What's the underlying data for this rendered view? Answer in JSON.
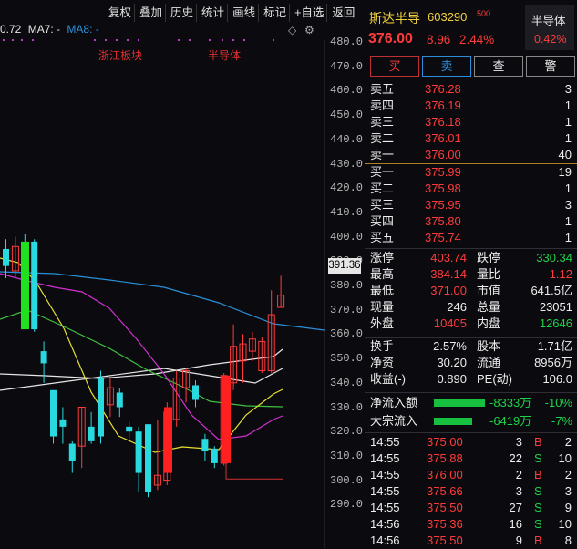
{
  "toolbar": {
    "buttons": [
      "复权",
      "叠加",
      "历史",
      "统计",
      "画线",
      "标记",
      "+自选",
      "返回"
    ]
  },
  "ma": {
    "prefix": "0.72",
    "ma7": "MA7: -",
    "ma8": "MA8: -"
  },
  "tags": {
    "t1": "浙江板块",
    "t2": "半导体"
  },
  "yaxis": [
    "480.0",
    "470.0",
    "460.0",
    "450.0",
    "440.0",
    "430.0",
    "420.0",
    "410.0",
    "400.0",
    "390.0",
    "380.0",
    "370.0",
    "360.0",
    "350.0",
    "340.0",
    "330.0",
    "320.0",
    "310.0",
    "300.0",
    "290.0"
  ],
  "price_marker": "391.36",
  "stock": {
    "name": "斯达半导",
    "code": "603290",
    "sup": "500",
    "price": "376.00",
    "change": "8.96",
    "pct": "2.44%",
    "sector": "半导体",
    "sector_pct": "0.42%"
  },
  "actions": {
    "buy": "买",
    "sell": "卖",
    "query": "查",
    "alert": "警"
  },
  "colors": {
    "up": "#ff3b3b",
    "down": "#1fd14a",
    "ma_white": "#e6e6e6",
    "ma_yellow": "#e8e030",
    "ma_magenta": "#d030d0",
    "ma_green": "#40c040",
    "ma_blue": "#2a8fd8"
  },
  "asks": [
    {
      "label": "卖五",
      "price": "376.28",
      "vol": "3"
    },
    {
      "label": "卖四",
      "price": "376.19",
      "vol": "1"
    },
    {
      "label": "卖三",
      "price": "376.18",
      "vol": "1"
    },
    {
      "label": "卖二",
      "price": "376.01",
      "vol": "1"
    },
    {
      "label": "卖一",
      "price": "376.00",
      "vol": "40"
    }
  ],
  "bids": [
    {
      "label": "买一",
      "price": "375.99",
      "vol": "19"
    },
    {
      "label": "买二",
      "price": "375.98",
      "vol": "1"
    },
    {
      "label": "买三",
      "price": "375.95",
      "vol": "3"
    },
    {
      "label": "买四",
      "price": "375.80",
      "vol": "1"
    },
    {
      "label": "买五",
      "price": "375.74",
      "vol": "1"
    }
  ],
  "stats": {
    "zt_label": "涨停",
    "zt": "403.74",
    "dt_label": "跌停",
    "dt": "330.34",
    "high_label": "最高",
    "high": "384.14",
    "lb_label": "量比",
    "lb": "1.12",
    "low_label": "最低",
    "low": "371.00",
    "mv_label": "市值",
    "mv": "641.5亿",
    "xs_label": "现量",
    "xs": "246",
    "zl_label": "总量",
    "zl": "23051",
    "wp_label": "外盘",
    "wp": "10405",
    "np_label": "内盘",
    "np": "12646",
    "hs_label": "换手",
    "hs": "2.57%",
    "gb_label": "股本",
    "gb": "1.71亿",
    "jz_label": "净资",
    "jz": "30.20",
    "lt_label": "流通",
    "lt": "8956万",
    "sy_label": "收益(-)",
    "sy": "0.890",
    "pe_label": "PE(动)",
    "pe": "106.0"
  },
  "flows": [
    {
      "label": "净流入额",
      "value": "-8333万",
      "pct": "-10%",
      "bar": 0.1
    },
    {
      "label": "大宗流入",
      "value": "-6419万",
      "pct": "-7%",
      "bar": 0.07
    }
  ],
  "ticks": [
    {
      "time": "14:55",
      "price": "375.00",
      "vol": "3",
      "side": "B",
      "num": "2"
    },
    {
      "time": "14:55",
      "price": "375.88",
      "vol": "22",
      "side": "S",
      "num": "10"
    },
    {
      "time": "14:55",
      "price": "376.00",
      "vol": "2",
      "side": "B",
      "num": "2"
    },
    {
      "time": "14:55",
      "price": "375.66",
      "vol": "3",
      "side": "S",
      "num": "3"
    },
    {
      "time": "14:55",
      "price": "375.50",
      "vol": "27",
      "side": "S",
      "num": "9"
    },
    {
      "time": "14:56",
      "price": "375.36",
      "vol": "16",
      "side": "S",
      "num": "10"
    },
    {
      "time": "14:56",
      "price": "375.50",
      "vol": "9",
      "side": "B",
      "num": "8"
    }
  ],
  "chart_data": {
    "type": "candlestick",
    "price_range": [
      285,
      485
    ],
    "candles": [
      {
        "o": 395,
        "c": 388,
        "h": 399,
        "l": 383
      },
      {
        "o": 386,
        "c": 396,
        "h": 400,
        "l": 383
      },
      {
        "o": 396,
        "c": 391,
        "h": 401,
        "l": 389
      },
      {
        "o": 398,
        "c": 362,
        "h": 399,
        "l": 361
      },
      {
        "o": 353,
        "c": 348,
        "h": 357,
        "l": 340
      },
      {
        "o": 337,
        "c": 318,
        "h": 337,
        "l": 315
      },
      {
        "o": 325,
        "c": 322,
        "h": 330,
        "l": 315
      },
      {
        "o": 315,
        "c": 308,
        "h": 316,
        "l": 303
      },
      {
        "o": 314,
        "c": 330,
        "h": 330,
        "l": 305
      },
      {
        "o": 322,
        "c": 316,
        "h": 328,
        "l": 315
      },
      {
        "o": 342,
        "c": 318,
        "h": 345,
        "l": 315
      },
      {
        "o": 331,
        "c": 338,
        "h": 342,
        "l": 326
      },
      {
        "o": 336,
        "c": 330,
        "h": 338,
        "l": 326
      },
      {
        "o": 322,
        "c": 320,
        "h": 324,
        "l": 317
      },
      {
        "o": 320,
        "c": 303,
        "h": 322,
        "l": 295
      },
      {
        "o": 323,
        "c": 295,
        "h": 323,
        "l": 293
      },
      {
        "o": 298,
        "c": 302,
        "h": 325,
        "l": 296
      },
      {
        "o": 300,
        "c": 328,
        "h": 332,
        "l": 298
      },
      {
        "o": 325,
        "c": 342,
        "h": 345,
        "l": 322
      },
      {
        "o": 338,
        "c": 345,
        "h": 346,
        "l": 332
      },
      {
        "o": 339,
        "c": 333,
        "h": 341,
        "l": 330
      },
      {
        "o": 317,
        "c": 312,
        "h": 319,
        "l": 308
      },
      {
        "o": 313,
        "c": 307,
        "h": 314,
        "l": 305
      },
      {
        "o": 307,
        "c": 343,
        "h": 344,
        "l": 306
      },
      {
        "o": 340,
        "c": 355,
        "h": 364,
        "l": 337
      },
      {
        "o": 349,
        "c": 356,
        "h": 360,
        "l": 340
      },
      {
        "o": 353,
        "c": 358,
        "h": 361,
        "l": 349
      },
      {
        "o": 345,
        "c": 357,
        "h": 359,
        "l": 344
      },
      {
        "o": 345,
        "c": 368,
        "h": 378,
        "l": 344
      },
      {
        "o": 371,
        "c": 376,
        "h": 384,
        "l": 371
      }
    ]
  }
}
